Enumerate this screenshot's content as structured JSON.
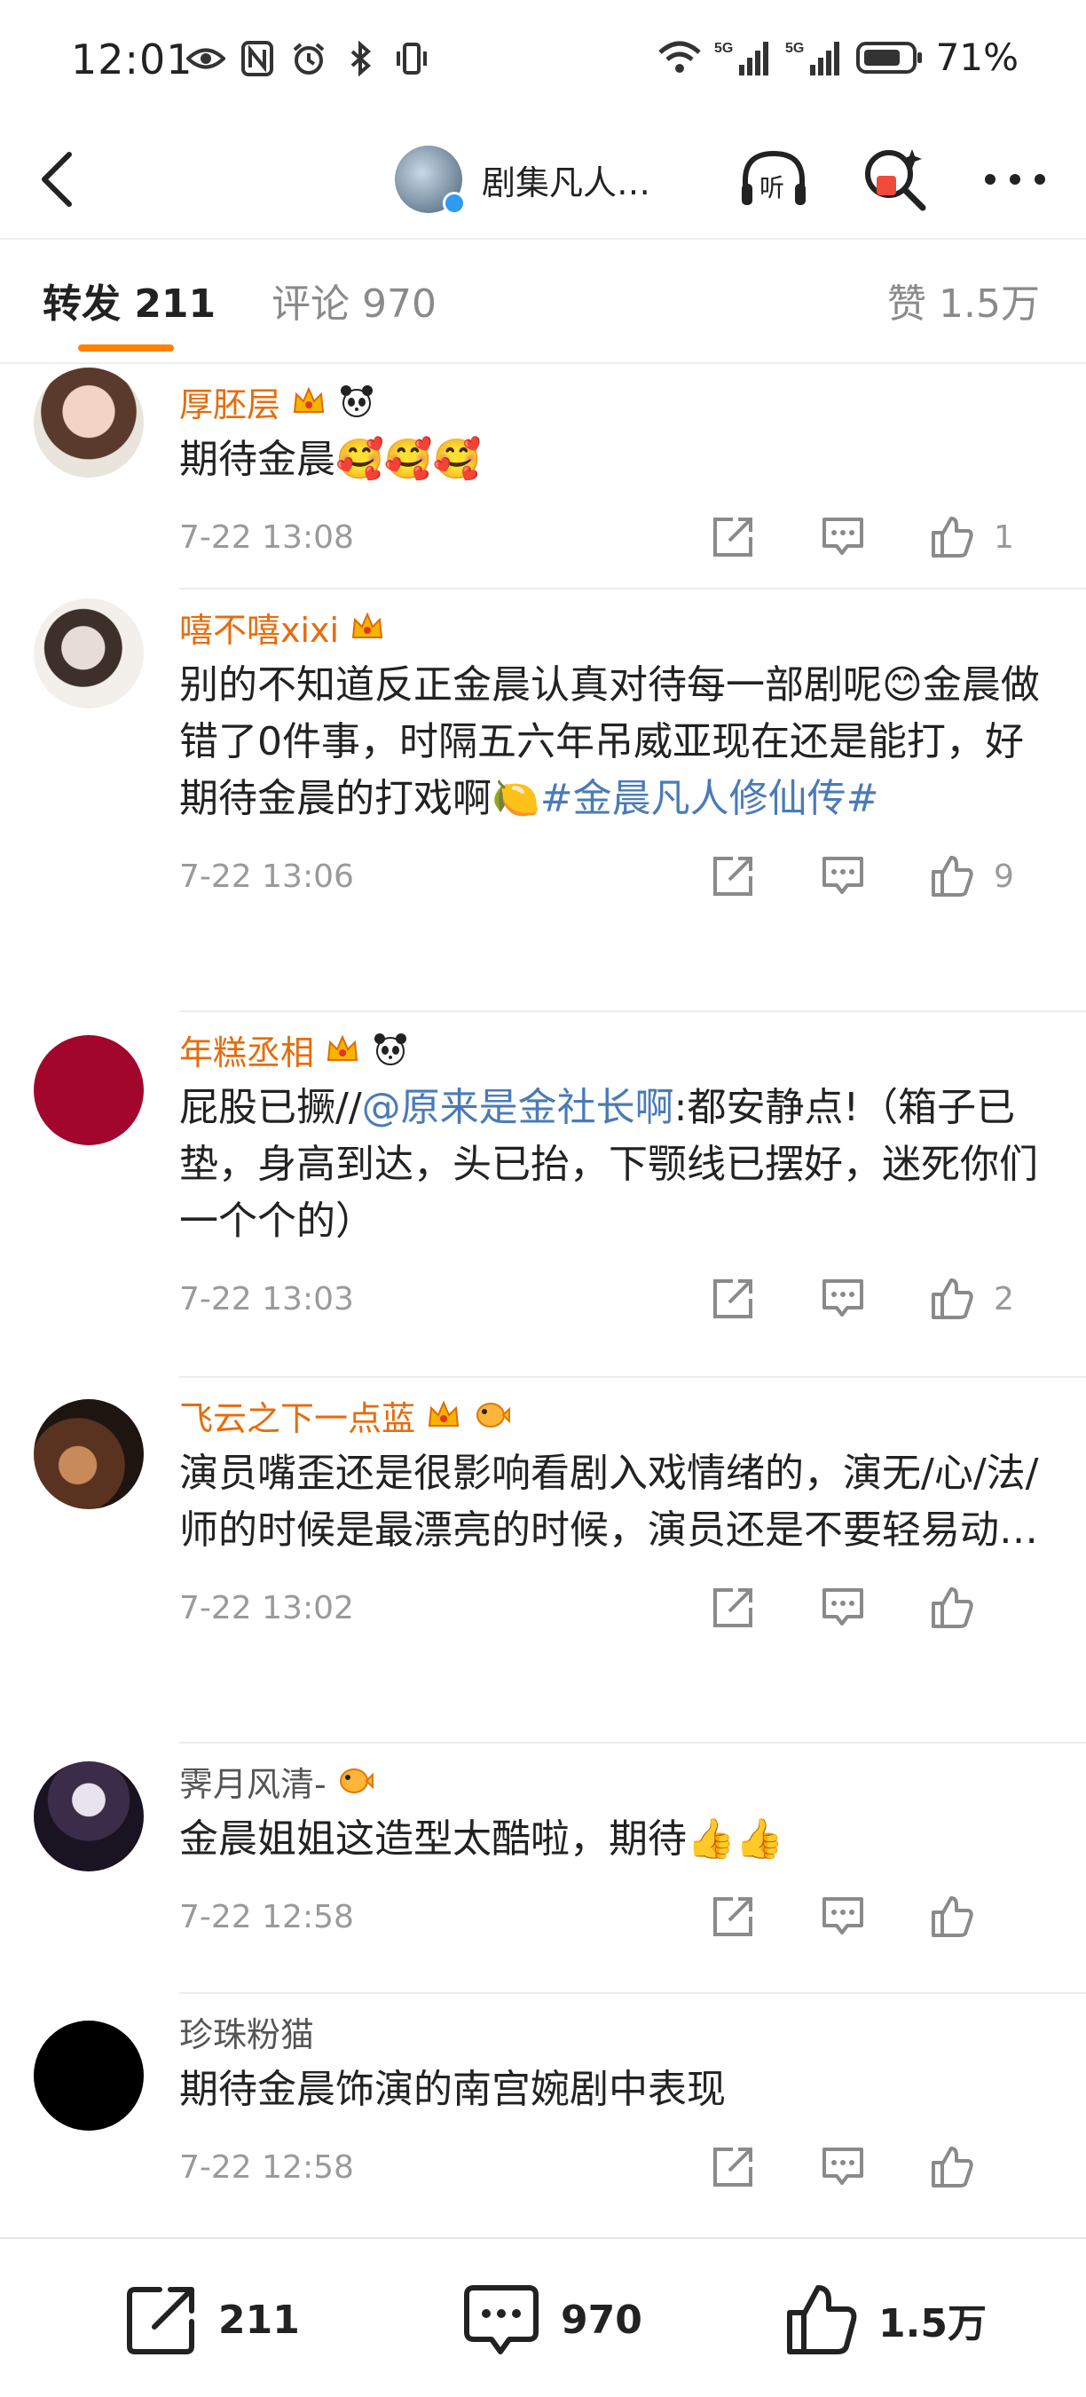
{
  "status_bar": {
    "time": "12:01",
    "battery_percent": "71%",
    "signal_1": "5G",
    "signal_2": "5G"
  },
  "nav": {
    "title": "剧集凡人…",
    "icons": [
      "back-icon",
      "listen-icon",
      "search-ai-icon",
      "more-icon"
    ]
  },
  "tabs": {
    "repost": "转发 211",
    "comments": "评论 970",
    "likes": "赞 1.5万"
  },
  "comments": [
    {
      "name": "厚胚层",
      "badges": [
        "crown-badge",
        "panda-badge"
      ],
      "text": "期待金晨🥰🥰🥰",
      "time": "7-22 13:08",
      "likes": "1"
    },
    {
      "name": "嘻不嘻xixi",
      "badges": [
        "crown-badge"
      ],
      "text": "别的不知道反正金晨认真对待每一部剧呢😊金晨做错了0件事，时隔五六年吊威亚现在还是能打，好期待金晨的打戏啊🍋",
      "hashtag": "#金晨凡人修仙传#",
      "time": "7-22 13:06",
      "likes": "9"
    },
    {
      "name": "年糕丞相",
      "badges": [
        "crown-badge",
        "panda-badge"
      ],
      "text_before": "屁股已撅//",
      "mention": "@原来是金社长啊",
      "text_after": ":都安静点!（箱子已垫，身高到达，头已抬，下颚线已摆好，迷死你们一个个的）",
      "time": "7-22 13:03",
      "likes": "2"
    },
    {
      "name": "飞云之下一点蓝",
      "badges": [
        "crown-badge",
        "pufferfish-badge"
      ],
      "text": "演员嘴歪还是很影响看剧入戏情绪的，演无/心/法/师的时候是最漂亮的时候，演员还是不要轻易动…",
      "time": "7-22 13:02",
      "likes": ""
    },
    {
      "name": "霁月风清-",
      "badges": [
        "pufferfish-badge"
      ],
      "text": "金晨姐姐这造型太酷啦，期待👍👍",
      "time": "7-22 12:58",
      "likes": ""
    },
    {
      "name": "珍珠粉猫",
      "badges": [],
      "text": "期待金晨饰演的南宫婉剧中表现",
      "time": "7-22 12:58",
      "likes": ""
    }
  ],
  "bottom_bar": {
    "repost_count": "211",
    "comment_count": "970",
    "like_count": "1.5万"
  },
  "colors": {
    "accent": "#ff8200",
    "username": "#e86b0a",
    "link": "#4a7bb7",
    "meta": "#9a9a9a"
  }
}
